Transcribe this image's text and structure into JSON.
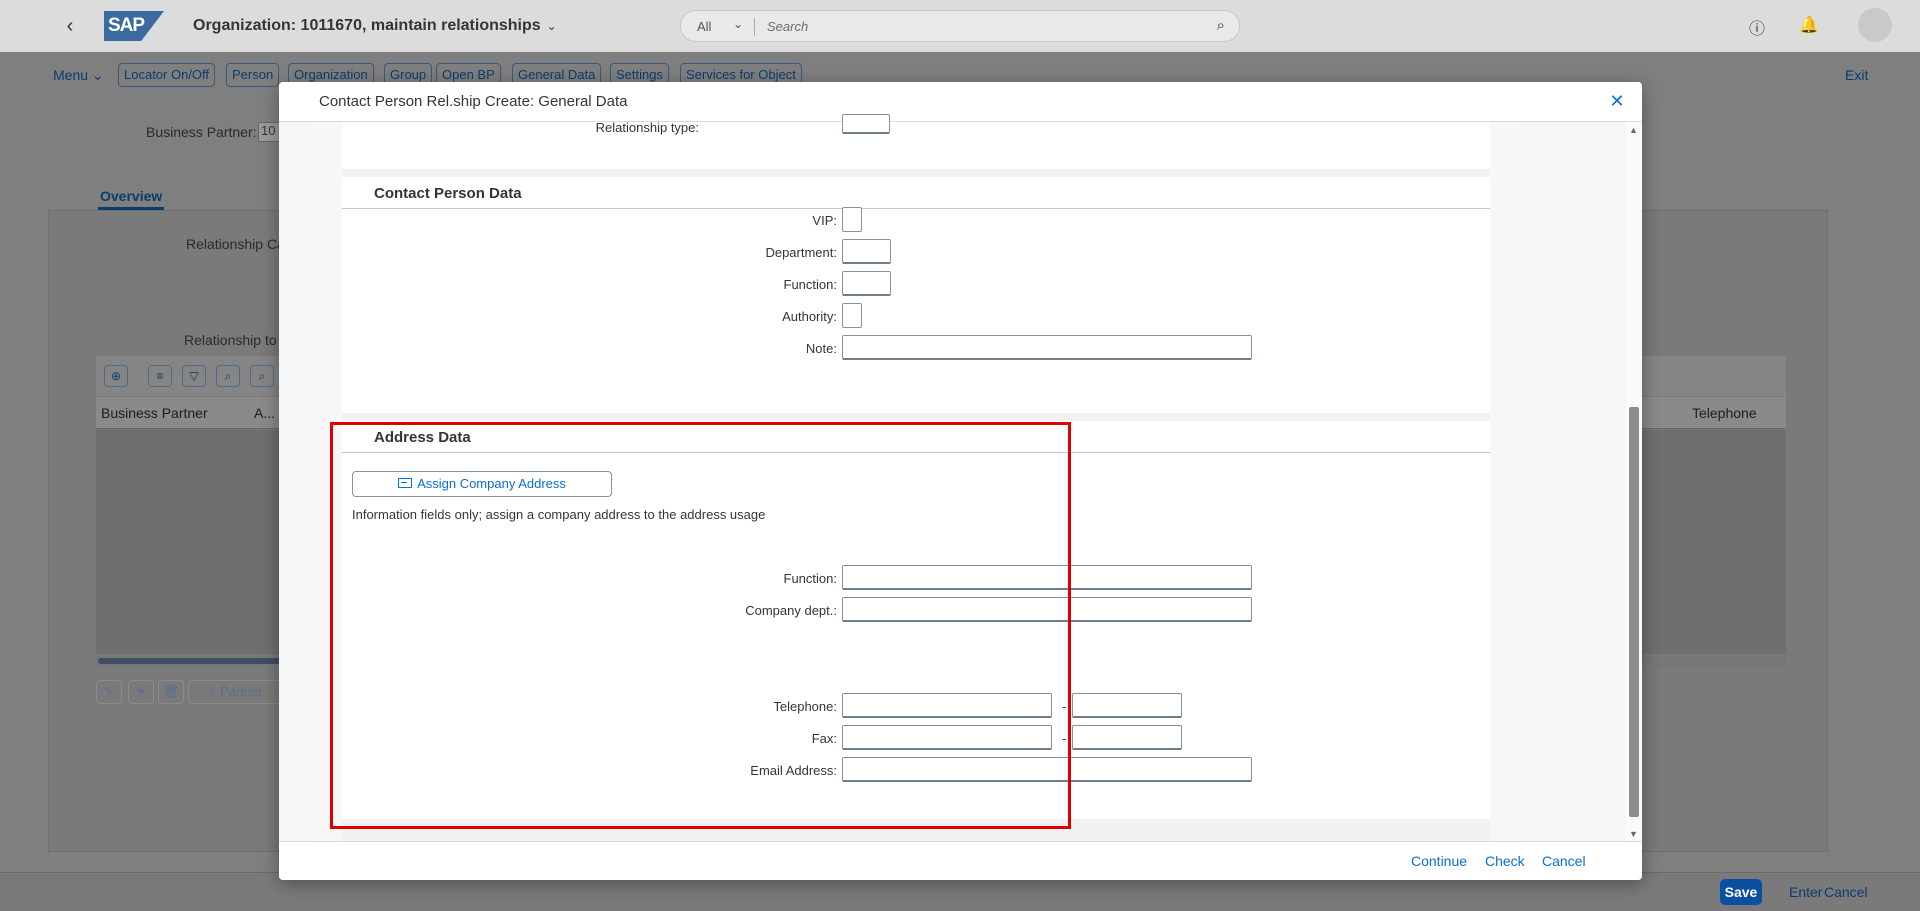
{
  "shell": {
    "title": "Organization: 1011670, maintain relationships",
    "search_scope": "All",
    "search_placeholder": "Search"
  },
  "toolbar": {
    "menu": "Menu",
    "buttons": [
      "Locator On/Off",
      "Person",
      "Organization",
      "Group",
      "Open BP",
      "General Data",
      "Settings",
      "Services for Object"
    ],
    "exit": "Exit"
  },
  "background": {
    "bp_label": "Business Partner:",
    "bp_value": "10",
    "tab_overview": "Overview",
    "relationship_cat_label": "Relationship Ca",
    "relationship_to_label": "Relationship to",
    "table_headers": [
      "Business Partner",
      "A...",
      "Telephone"
    ],
    "partner_button": "Partner"
  },
  "footer": {
    "save": "Save",
    "enter": "Enter",
    "cancel": "Cancel"
  },
  "dialog": {
    "title": "Contact Person Rel.ship Create: General Data",
    "relationship_type_label": "Relationship type:",
    "contact_section": {
      "title": "Contact Person Data",
      "vip_label": "VIP:",
      "department_label": "Department:",
      "function_label": "Function:",
      "authority_label": "Authority:",
      "note_label": "Note:"
    },
    "address_section": {
      "title": "Address Data",
      "assign_button": "Assign Company Address",
      "info": "Information fields only; assign a company address to the address usage",
      "function_label": "Function:",
      "company_dept_label": "Company dept.:",
      "telephone_label": "Telephone:",
      "fax_label": "Fax:",
      "email_label": "Email Address:",
      "dash": "-"
    },
    "footer": {
      "continue": "Continue",
      "check": "Check",
      "cancel": "Cancel"
    }
  },
  "colors": {
    "accent": "#0a6ed1",
    "highlight": "#e00000",
    "save_button": "#0a4fa0"
  }
}
